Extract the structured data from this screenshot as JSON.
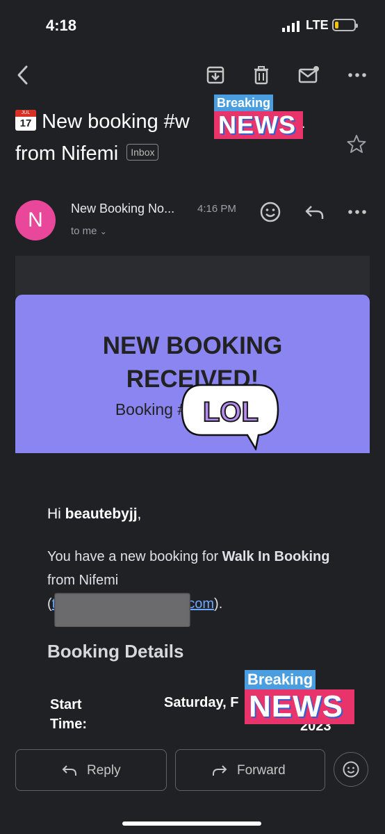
{
  "status": {
    "time": "4:18",
    "network": "LTE"
  },
  "toolbar": {
    "back": "back-arrow",
    "archive": "archive-icon",
    "delete": "trash-icon",
    "mark": "mail-icon",
    "more": "more-icon"
  },
  "email": {
    "subject_start": "New booking #w",
    "subject_end": "1",
    "subject_line2": "from Nifemi",
    "label": "Inbox",
    "calendar_month": "JUL",
    "calendar_day": "17",
    "avatar_letter": "N",
    "sender": "New Booking No...",
    "time": "4:16 PM",
    "recipient": "to me"
  },
  "body": {
    "hero_title": "NEW BOOKING RECEIVED!",
    "hero_sub_start": "Booking #",
    "hero_sub_end": "",
    "greeting_prefix": "Hi ",
    "greeting_name": "beautebyjj",
    "greeting_suffix": ",",
    "para_text1": "You have a new booking for ",
    "para_bold": "Walk In Booking",
    "para_text2": " from Nifemi",
    "para_open": "(",
    "para_link_start": "t",
    "para_link_end": "com",
    "para_close": ").",
    "details_heading": "Booking Details",
    "start_label_1": "Start",
    "start_label_2": "Time:",
    "start_value": "Saturday, F",
    "year_fragment": "2023"
  },
  "stickers": {
    "breaking": "Breaking",
    "news": "NEWS",
    "lol": "LOL"
  },
  "actions": {
    "reply": "Reply",
    "forward": "Forward"
  },
  "colors": {
    "background": "#202124",
    "hero": "#8a85f0",
    "avatar": "#e8479a",
    "link": "#6ea8fe"
  }
}
